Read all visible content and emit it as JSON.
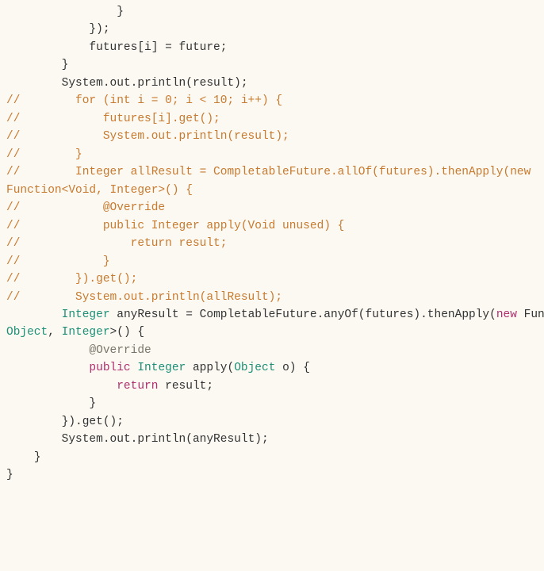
{
  "code": {
    "lines": [
      {
        "indent": 16,
        "segments": [
          {
            "cls": "punct",
            "t": "}"
          }
        ]
      },
      {
        "indent": 12,
        "segments": [
          {
            "cls": "punct",
            "t": "});"
          }
        ]
      },
      {
        "indent": 12,
        "segments": [
          {
            "cls": "text",
            "t": "futures[i] = future;"
          }
        ]
      },
      {
        "indent": 8,
        "segments": [
          {
            "cls": "punct",
            "t": "}"
          }
        ]
      },
      {
        "indent": 8,
        "segments": [
          {
            "cls": "text",
            "t": "System.out.println(result);"
          }
        ]
      },
      {
        "indent": 0,
        "segments": [
          {
            "cls": "text",
            "t": ""
          }
        ]
      },
      {
        "indent": 0,
        "segments": [
          {
            "cls": "comment",
            "t": "//        for (int i = 0; i < 10; i++) {"
          }
        ]
      },
      {
        "indent": 0,
        "segments": [
          {
            "cls": "comment",
            "t": "//            futures[i].get();"
          }
        ]
      },
      {
        "indent": 0,
        "segments": [
          {
            "cls": "comment",
            "t": "//            System.out.println(result);"
          }
        ]
      },
      {
        "indent": 0,
        "segments": [
          {
            "cls": "comment",
            "t": "//        }"
          }
        ]
      },
      {
        "indent": 0,
        "segments": [
          {
            "cls": "text",
            "t": ""
          }
        ]
      },
      {
        "indent": 0,
        "segments": [
          {
            "cls": "comment",
            "t": "//        Integer allResult = CompletableFuture.allOf(futures).thenApply(new Function<Void, Integer>() {"
          }
        ]
      },
      {
        "indent": 0,
        "segments": [
          {
            "cls": "comment",
            "t": "//            @Override"
          }
        ]
      },
      {
        "indent": 0,
        "segments": [
          {
            "cls": "comment",
            "t": "//            public Integer apply(Void unused) {"
          }
        ]
      },
      {
        "indent": 0,
        "segments": [
          {
            "cls": "comment",
            "t": "//                return result;"
          }
        ]
      },
      {
        "indent": 0,
        "segments": [
          {
            "cls": "comment",
            "t": "//            }"
          }
        ]
      },
      {
        "indent": 0,
        "segments": [
          {
            "cls": "comment",
            "t": "//        }).get();"
          }
        ]
      },
      {
        "indent": 0,
        "segments": [
          {
            "cls": "text",
            "t": ""
          }
        ]
      },
      {
        "indent": 0,
        "segments": [
          {
            "cls": "comment",
            "t": "//        System.out.println(allResult);"
          }
        ]
      },
      {
        "indent": 0,
        "segments": [
          {
            "cls": "text",
            "t": ""
          }
        ]
      },
      {
        "indent": 8,
        "segments": [
          {
            "cls": "type",
            "t": "Integer"
          },
          {
            "cls": "text",
            "t": " anyResult = CompletableFuture.anyOf(futures).thenApply("
          },
          {
            "cls": "keyword",
            "t": "new"
          },
          {
            "cls": "text",
            "t": " Function<"
          },
          {
            "cls": "type",
            "t": "Object"
          },
          {
            "cls": "text",
            "t": ", "
          },
          {
            "cls": "type",
            "t": "Integer"
          },
          {
            "cls": "text",
            "t": ">() {"
          }
        ]
      },
      {
        "indent": 12,
        "segments": [
          {
            "cls": "annotation",
            "t": "@Override"
          }
        ]
      },
      {
        "indent": 12,
        "segments": [
          {
            "cls": "keyword",
            "t": "public"
          },
          {
            "cls": "text",
            "t": " "
          },
          {
            "cls": "type",
            "t": "Integer"
          },
          {
            "cls": "text",
            "t": " apply("
          },
          {
            "cls": "type",
            "t": "Object"
          },
          {
            "cls": "text",
            "t": " o) {"
          }
        ]
      },
      {
        "indent": 16,
        "segments": [
          {
            "cls": "keyword",
            "t": "return"
          },
          {
            "cls": "text",
            "t": " result;"
          }
        ]
      },
      {
        "indent": 12,
        "segments": [
          {
            "cls": "punct",
            "t": "}"
          }
        ]
      },
      {
        "indent": 8,
        "segments": [
          {
            "cls": "text",
            "t": "}).get();"
          }
        ]
      },
      {
        "indent": 8,
        "segments": [
          {
            "cls": "text",
            "t": "System.out.println(anyResult);"
          }
        ]
      },
      {
        "indent": 0,
        "segments": [
          {
            "cls": "text",
            "t": ""
          }
        ]
      },
      {
        "indent": 4,
        "segments": [
          {
            "cls": "punct",
            "t": "}"
          }
        ]
      },
      {
        "indent": 0,
        "segments": [
          {
            "cls": "punct",
            "t": "}"
          }
        ]
      }
    ]
  }
}
